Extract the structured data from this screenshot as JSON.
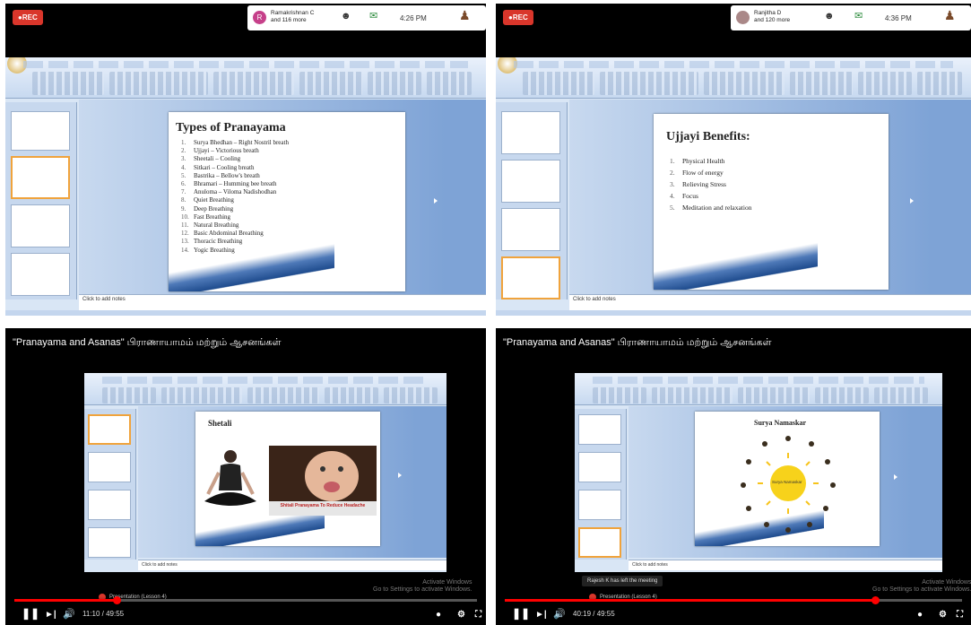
{
  "rec_label": "REC",
  "q1": {
    "participant": "Ramakrishnan C\nand 116 more",
    "avatar_letter": "R",
    "time": "4:26 PM",
    "slide_title": "Types of Pranayama",
    "slide_items": [
      "Surya Bhedhan – Right Nostril breath",
      "Ujjayi – Victorious breath",
      "Sheetali – Cooling",
      "Sitkari – Cooling breath",
      "Bastrika – Bellow's breath",
      "Bhramari – Humming bee breath",
      "Anuloma – Viloma Nadishodhan",
      "Quiet Breathing",
      "Deep Breathing",
      "Fast Breathing",
      "Natural Breathing",
      "Basic Abdominal Breathing",
      "Thoracic Breathing",
      "Yogic Breathing"
    ],
    "notes": "Click to add notes"
  },
  "q2": {
    "participant": "Ranjitha D\nand 120 more",
    "time": "4:36 PM",
    "slide_title": "Ujjayi Benefits:",
    "slide_items": [
      "Physical Health",
      "Flow of energy",
      "Relieving Stress",
      "Focus",
      "Meditation and relaxation"
    ],
    "notes": "Click to add notes"
  },
  "q3": {
    "video_title": "\"Pranayama and Asanas\" பிராணாயாமம் மற்றும் ஆசனங்கள்",
    "slide_title": "Shetali",
    "banner": "Shitali Pranayama To Reduce Headache",
    "notes": "Click to add notes",
    "activate": "Activate Windows\nGo to Settings to activate Windows.",
    "rec_label": "Presentation (Lesson 4)",
    "time": "11:10 / 49:55",
    "progress": 0.22
  },
  "q4": {
    "video_title": "\"Pranayama and Asanas\" பிராணாயாமம் மற்றும் ஆசனங்கள்",
    "slide_title": "Surya Namaskar",
    "sun_label": "Surya Namaskar",
    "notes": "Click to add notes",
    "toast": "Rajesh K has left the meeting",
    "rec_label": "Presentation (Lesson 4)",
    "activate": "Activate Windows\nGo to Settings to activate Windows.",
    "time": "40:19 / 49:55",
    "progress": 0.81
  },
  "colors": {
    "rec": "#d9362b",
    "progress": "#ff0000",
    "slide_accent": "#1f4c8e"
  },
  "icons": [
    "participants-icon",
    "chat-icon",
    "user-icon",
    "play-icon",
    "pause-icon",
    "next-icon",
    "volume-icon",
    "settings-icon",
    "fullscreen-icon"
  ]
}
